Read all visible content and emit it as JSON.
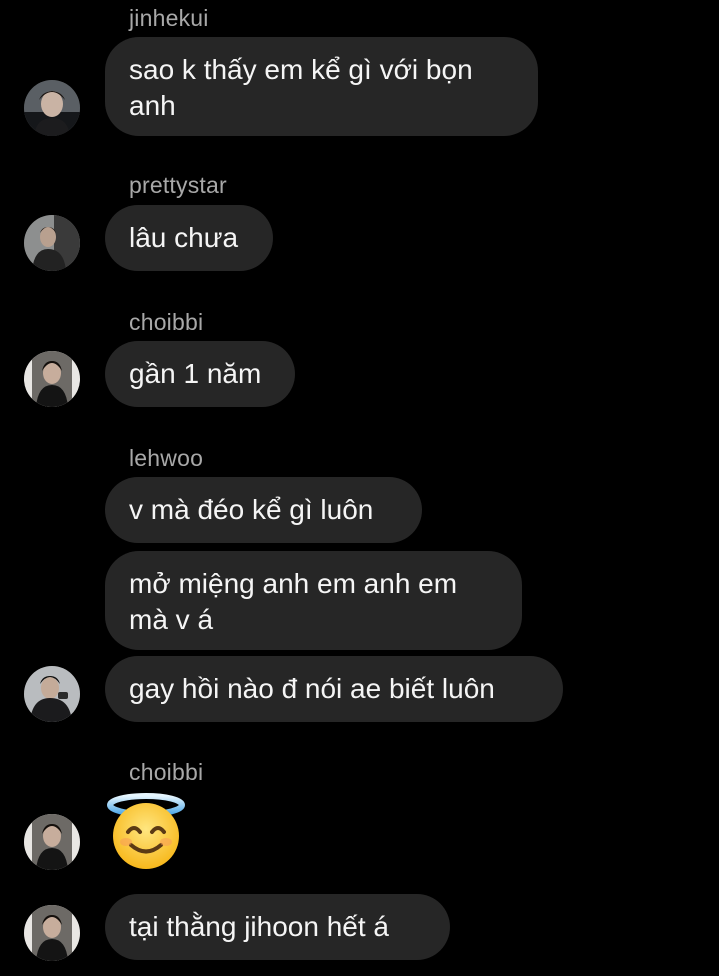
{
  "colors": {
    "background": "#000000",
    "bubble": "#262626",
    "username": "#a8a8a8",
    "text": "#f5f5f5"
  },
  "messages": [
    {
      "user": "jinhekui",
      "text": "sao k thấy em kể gì với bọn anh"
    },
    {
      "user": "prettystar",
      "text": "lâu chưa"
    },
    {
      "user": "choibbi",
      "text": "gần 1 năm"
    },
    {
      "user": "lehwoo",
      "texts": [
        "v mà đéo kể gì luôn",
        "mở miệng anh em anh em mà v á",
        "gay hồi nào đ nói ae biết luôn"
      ]
    },
    {
      "user": "choibbi",
      "emoji": "smiling-face-with-halo-emoji"
    },
    {
      "user": "choibbi",
      "text": "tại thằng jihoon hết á"
    }
  ]
}
